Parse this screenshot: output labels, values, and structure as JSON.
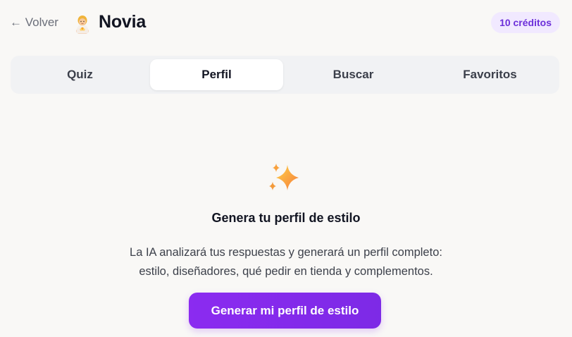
{
  "header": {
    "back_label": "← Volver",
    "avatar_icon": "bride-icon",
    "title": "Novia",
    "credits": "10 créditos"
  },
  "tabs": [
    {
      "label": "Quiz",
      "active": false
    },
    {
      "label": "Perfil",
      "active": true
    },
    {
      "label": "Buscar",
      "active": false
    },
    {
      "label": "Favoritos",
      "active": false
    }
  ],
  "empty_state": {
    "icon": "sparkles-icon",
    "heading": "Genera tu perfil de estilo",
    "description_line1": "La IA analizará tus respuestas y generará un perfil completo:",
    "description_line2": "estilo, diseñadores, qué pedir en tienda y complementos.",
    "button_label": "Generar mi perfil de estilo"
  },
  "colors": {
    "accent": "#8b2bf0",
    "credits_bg": "#f1e9ff",
    "credits_text": "#6c2fd9",
    "background": "#f9f8f6"
  }
}
